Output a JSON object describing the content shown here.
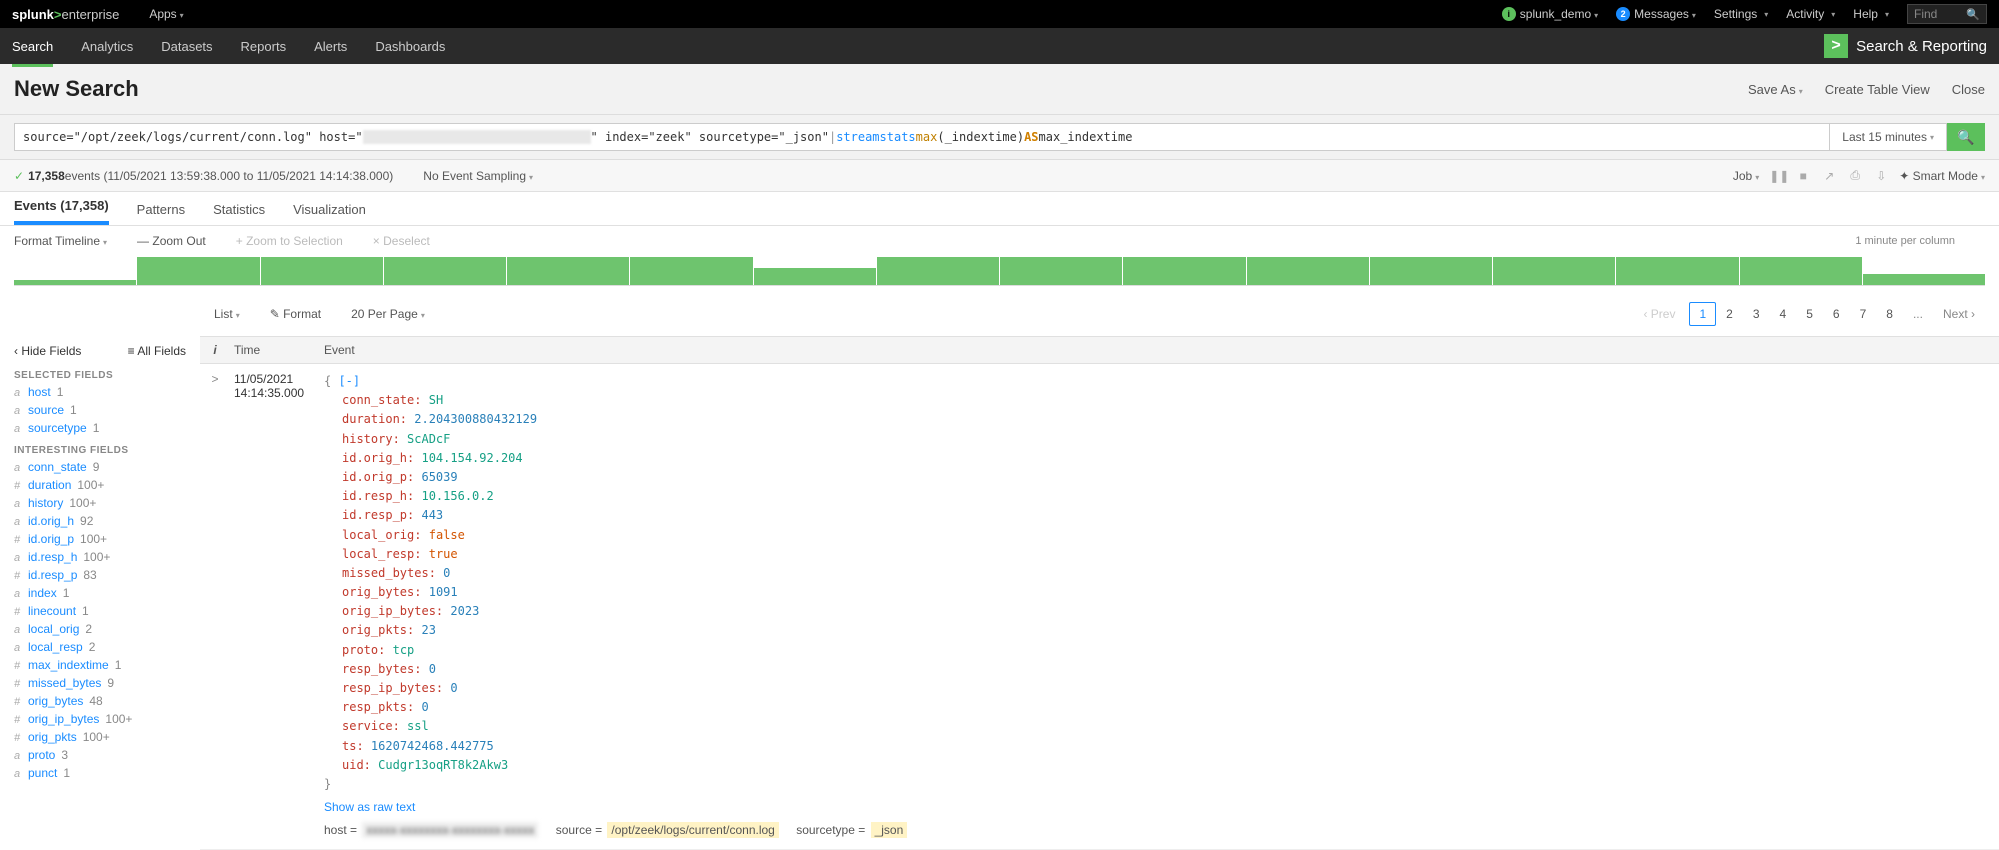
{
  "topbar": {
    "logo_pre": "splunk",
    "logo_gt": ">",
    "logo_post": "enterprise",
    "apps": "Apps",
    "user": "splunk_demo",
    "messages": "Messages",
    "messages_badge": "2",
    "settings": "Settings",
    "activity": "Activity",
    "help": "Help",
    "find_placeholder": "Find"
  },
  "navbar": {
    "tabs": [
      "Search",
      "Analytics",
      "Datasets",
      "Reports",
      "Alerts",
      "Dashboards"
    ],
    "active": 0,
    "brand": "Search & Reporting"
  },
  "title": {
    "heading": "New Search",
    "save_as": "Save As",
    "create_table": "Create Table View",
    "close": "Close"
  },
  "search": {
    "pre": "source=\"/opt/zeek/logs/current/conn.log\" host=\"",
    "redacted": "xxxxxx-xxxxxxxxx-xxxxxxxx-xxxxx",
    "mid": "\" index=\"zeek\" sourcetype=\"_json\" ",
    "pipe": "| ",
    "cmd": "streamstats ",
    "func": "max",
    "arg": "(_indextime) ",
    "as": "AS",
    "tail": " max_indextime",
    "time_range": "Last 15 minutes"
  },
  "status": {
    "count": "17,358",
    "events_label": " events",
    "range": "(11/05/2021 13:59:38.000 to 11/05/2021 14:14:38.000)",
    "no_sampling": "No Event Sampling",
    "job": "Job",
    "smart_mode": "Smart Mode"
  },
  "restabs": {
    "events": "Events (17,358)",
    "patterns": "Patterns",
    "statistics": "Statistics",
    "visualization": "Visualization"
  },
  "tl": {
    "format": "Format Timeline",
    "zoom_out": "— Zoom Out",
    "zoom_sel": "+ Zoom to Selection",
    "deselect": "× Deselect",
    "per_min": "1 minute per column",
    "bars": [
      18,
      100,
      100,
      100,
      100,
      100,
      60,
      100,
      100,
      100,
      100,
      100,
      100,
      100,
      100,
      40
    ]
  },
  "listctrl": {
    "list": "List",
    "format": "Format",
    "perpage": "20 Per Page",
    "prev": "Prev",
    "next": "Next",
    "pages": [
      "1",
      "2",
      "3",
      "4",
      "5",
      "6",
      "7",
      "8",
      "...",
      "Next"
    ]
  },
  "fields": {
    "hide": "Hide Fields",
    "all": "All Fields",
    "selected_label": "SELECTED FIELDS",
    "selected": [
      {
        "t": "a",
        "n": "host",
        "c": "1"
      },
      {
        "t": "a",
        "n": "source",
        "c": "1"
      },
      {
        "t": "a",
        "n": "sourcetype",
        "c": "1"
      }
    ],
    "interesting_label": "INTERESTING FIELDS",
    "interesting": [
      {
        "t": "a",
        "n": "conn_state",
        "c": "9"
      },
      {
        "t": "#",
        "n": "duration",
        "c": "100+"
      },
      {
        "t": "a",
        "n": "history",
        "c": "100+"
      },
      {
        "t": "a",
        "n": "id.orig_h",
        "c": "92"
      },
      {
        "t": "#",
        "n": "id.orig_p",
        "c": "100+"
      },
      {
        "t": "a",
        "n": "id.resp_h",
        "c": "100+"
      },
      {
        "t": "#",
        "n": "id.resp_p",
        "c": "83"
      },
      {
        "t": "a",
        "n": "index",
        "c": "1"
      },
      {
        "t": "#",
        "n": "linecount",
        "c": "1"
      },
      {
        "t": "a",
        "n": "local_orig",
        "c": "2"
      },
      {
        "t": "a",
        "n": "local_resp",
        "c": "2"
      },
      {
        "t": "#",
        "n": "max_indextime",
        "c": "1"
      },
      {
        "t": "#",
        "n": "missed_bytes",
        "c": "9"
      },
      {
        "t": "#",
        "n": "orig_bytes",
        "c": "48"
      },
      {
        "t": "#",
        "n": "orig_ip_bytes",
        "c": "100+"
      },
      {
        "t": "#",
        "n": "orig_pkts",
        "c": "100+"
      },
      {
        "t": "a",
        "n": "proto",
        "c": "3"
      },
      {
        "t": "a",
        "n": "punct",
        "c": "1"
      }
    ]
  },
  "table": {
    "hdr_i": "i",
    "hdr_time": "Time",
    "hdr_event": "Event",
    "row": {
      "date": "11/05/2021",
      "time": "14:14:35.000",
      "expand": ">",
      "open": "{ ",
      "collapse": "[-]",
      "close": "}",
      "kv": [
        {
          "k": "conn_state",
          "v": "SH",
          "t": "str"
        },
        {
          "k": "duration",
          "v": "2.204300880432129",
          "t": "num"
        },
        {
          "k": "history",
          "v": "ScADcF",
          "t": "str"
        },
        {
          "k": "id.orig_h",
          "v": "104.154.92.204",
          "t": "str"
        },
        {
          "k": "id.orig_p",
          "v": "65039",
          "t": "num"
        },
        {
          "k": "id.resp_h",
          "v": "10.156.0.2",
          "t": "str"
        },
        {
          "k": "id.resp_p",
          "v": "443",
          "t": "num"
        },
        {
          "k": "local_orig",
          "v": "false",
          "t": "bool"
        },
        {
          "k": "local_resp",
          "v": "true",
          "t": "bool"
        },
        {
          "k": "missed_bytes",
          "v": "0",
          "t": "num"
        },
        {
          "k": "orig_bytes",
          "v": "1091",
          "t": "num"
        },
        {
          "k": "orig_ip_bytes",
          "v": "2023",
          "t": "num"
        },
        {
          "k": "orig_pkts",
          "v": "23",
          "t": "num"
        },
        {
          "k": "proto",
          "v": "tcp",
          "t": "str"
        },
        {
          "k": "resp_bytes",
          "v": "0",
          "t": "num"
        },
        {
          "k": "resp_ip_bytes",
          "v": "0",
          "t": "num"
        },
        {
          "k": "resp_pkts",
          "v": "0",
          "t": "num"
        },
        {
          "k": "service",
          "v": "ssl",
          "t": "str"
        },
        {
          "k": "ts",
          "v": "1620742468.442775",
          "t": "num"
        },
        {
          "k": "uid",
          "v": "Cudgr13oqRT8k2Akw3",
          "t": "str"
        }
      ],
      "raw_link": "Show as raw text",
      "meta": {
        "host_k": "host =",
        "host_v": "xxxxx-xxxxxxxx-xxxxxxxx-xxxxx",
        "source_k": "source =",
        "source_v": "/opt/zeek/logs/current/conn.log",
        "st_k": "sourcetype =",
        "st_v": "_json"
      }
    }
  }
}
